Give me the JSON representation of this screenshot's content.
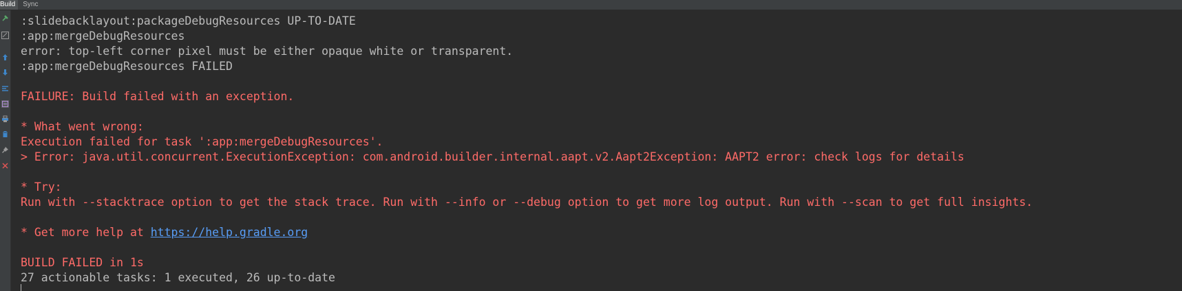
{
  "tabs": [
    {
      "label": "Build",
      "active": true
    },
    {
      "label": "Sync",
      "active": false
    }
  ],
  "gutter_icons": [
    "hammer-icon",
    "toggle-view-icon",
    "up-arrow-icon",
    "down-arrow-icon",
    "expand-icon",
    "collapse-icon",
    "print-icon",
    "trash-icon",
    "pin-icon",
    "close-icon"
  ],
  "console": {
    "lines": {
      "l1": ":slidebacklayout:packageDebugResources UP-TO-DATE",
      "l2": ":app:mergeDebugResources",
      "l3": "error: top-left corner pixel must be either opaque white or transparent.",
      "l4": ":app:mergeDebugResources FAILED",
      "l5": "FAILURE: Build failed with an exception.",
      "l6": "* What went wrong:",
      "l7": "Execution failed for task ':app:mergeDebugResources'.",
      "l8": "> Error: java.util.concurrent.ExecutionException: com.android.builder.internal.aapt.v2.Aapt2Exception: AAPT2 error: check logs for details",
      "l9": "* Try:",
      "l10": "Run with --stacktrace option to get the stack trace. Run with --info or --debug option to get more log output. Run with --scan to get full insights.",
      "l11_prefix": "* Get more help at ",
      "l11_link": "https://help.gradle.org",
      "l12": "BUILD FAILED in 1s",
      "l13": "27 actionable tasks: 1 executed, 26 up-to-date"
    }
  },
  "colors": {
    "background": "#2b2b2b",
    "normal_text": "#bbbbbb",
    "error_text": "#ff6b68",
    "link": "#589df6"
  }
}
